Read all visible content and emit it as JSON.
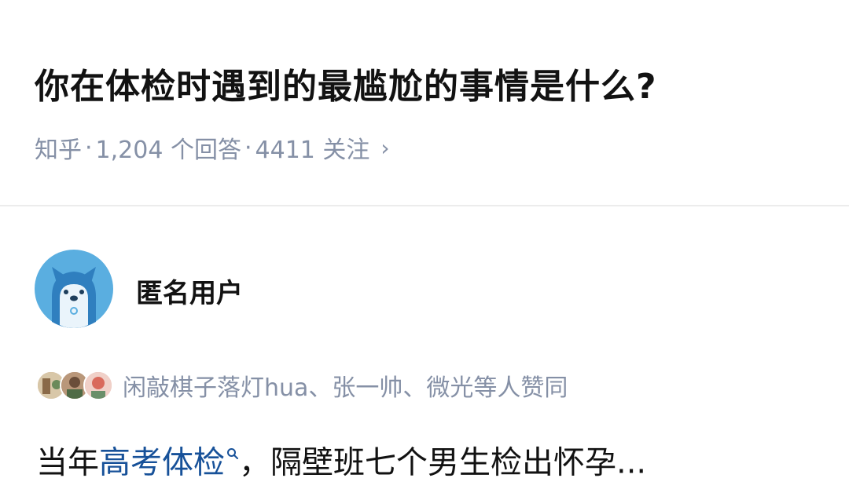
{
  "question": {
    "title": "你在体检时遇到的最尴尬的事情是什么?",
    "source": "知乎",
    "answers": "1,204 个回答",
    "follows": "4411 关注",
    "chevron": "›"
  },
  "answer": {
    "author_name": "匿名用户",
    "voters_text": "闲敲棋子落灯hua、张一帅、微光等人赞同",
    "content_prefix": "当年",
    "content_keyword": "高考体检",
    "content_suffix": "，隔壁班七个男生检出怀孕..."
  },
  "colors": {
    "link": "#175199",
    "meta": "#8590a6",
    "avatar_bg": "#5aaee0"
  }
}
